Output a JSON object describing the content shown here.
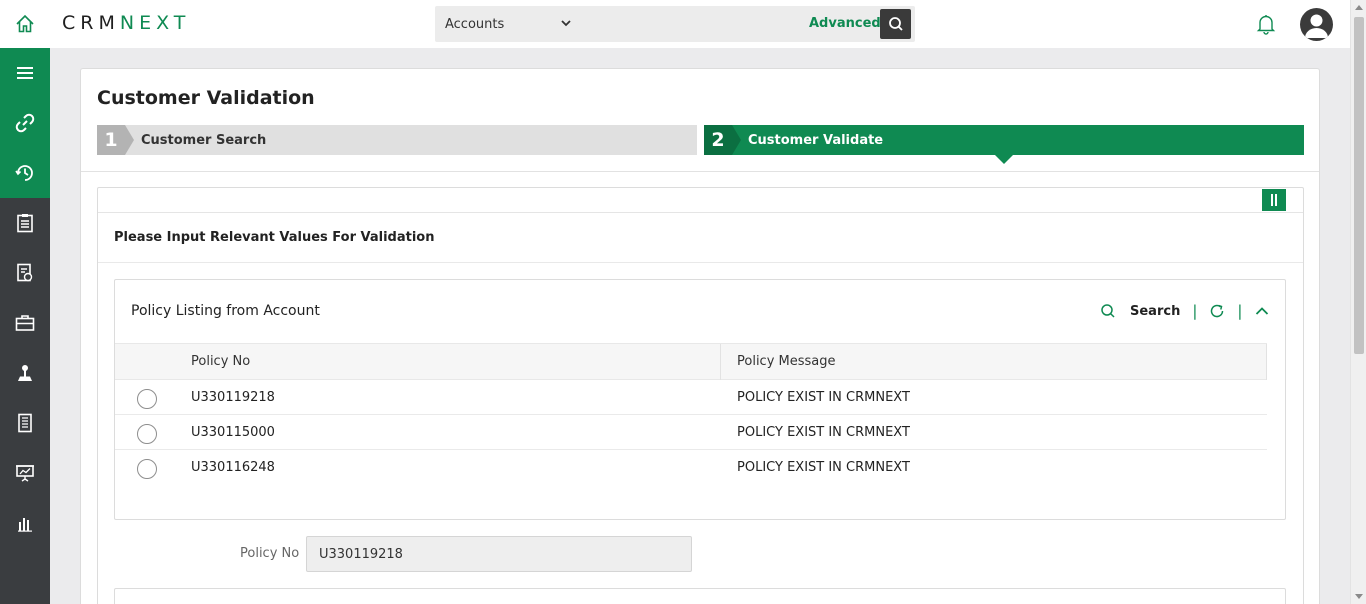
{
  "app": {
    "logo_prefix": "CRM",
    "logo_suffix": "NEXT"
  },
  "topbar": {
    "module": "Accounts",
    "search_placeholder": "",
    "advanced_label": "Advanced"
  },
  "colors": {
    "brand": "#0f8a52",
    "sidebar": "#3a3d40"
  },
  "sidebar": {
    "items": [
      {
        "icon": "menu-icon",
        "active": true
      },
      {
        "icon": "link-icon",
        "active": true
      },
      {
        "icon": "clock-icon",
        "active": true
      },
      {
        "icon": "clipboard-icon",
        "active": false
      },
      {
        "icon": "report-icon",
        "active": false
      },
      {
        "icon": "briefcase-icon",
        "active": false
      },
      {
        "icon": "joystick-icon",
        "active": false
      },
      {
        "icon": "ledger-icon",
        "active": false
      },
      {
        "icon": "presentation-icon",
        "active": false
      },
      {
        "icon": "bar-chart-icon",
        "active": false
      }
    ]
  },
  "page": {
    "title": "Customer Validation",
    "steps": [
      {
        "number": "1",
        "label": "Customer Search"
      },
      {
        "number": "2",
        "label": "Customer Validate"
      }
    ],
    "instruction": "Please Input Relevant Values For Validation"
  },
  "policy_panel": {
    "title": "Policy Listing from Account",
    "search_label": "Search",
    "columns": [
      "Policy No",
      "Policy Message"
    ],
    "rows": [
      {
        "policy_no": "U330119218",
        "message": "POLICY EXIST IN CRMNEXT"
      },
      {
        "policy_no": "U330115000",
        "message": "POLICY EXIST IN CRMNEXT"
      },
      {
        "policy_no": "U330116248",
        "message": "POLICY EXIST IN CRMNEXT"
      }
    ]
  },
  "policy_field": {
    "label": "Policy No",
    "value": "U330119218"
  }
}
